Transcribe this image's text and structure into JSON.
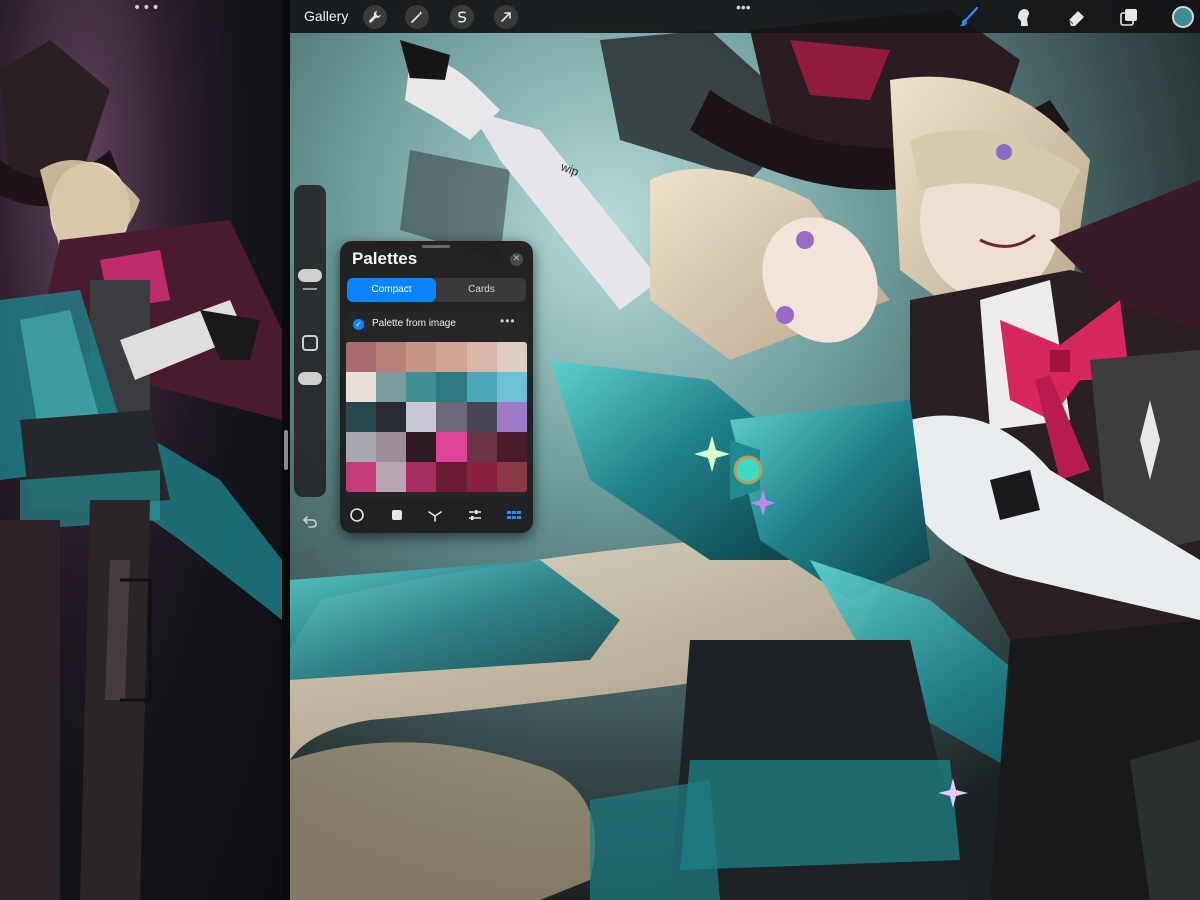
{
  "app": {
    "gallery_label": "Gallery",
    "toolbar_icons": [
      "wrench-icon",
      "magic-wand-icon",
      "selection-icon",
      "transform-arrow-icon",
      "brush-icon",
      "smudge-icon",
      "eraser-icon",
      "layers-icon",
      "color-swatch"
    ],
    "current_color": "#3e8b92",
    "accent": "#0a84ff"
  },
  "palettes": {
    "title": "Palettes",
    "tabs": [
      "Compact",
      "Cards"
    ],
    "active_tab": "Compact",
    "palette_name": "Palette from image",
    "default_checked": true,
    "swatches": [
      "#a86c6c",
      "#b88074",
      "#c89484",
      "#d2a494",
      "#dab6a8",
      "#e0cdc2",
      "#e8e0d8",
      "#7a9aa0",
      "#3f8e94",
      "#2e7a84",
      "#4aa8b8",
      "#6ec0d4",
      "#2a4850",
      "#2a2c34",
      "#c8c8d4",
      "#6a6a78",
      "#4a4458",
      "#a078c8",
      "#a8a8b0",
      "#9c8c96",
      "#301a24",
      "#e0449a",
      "#6a3444",
      "#4a1c2a",
      "#c43c7a",
      "#b8a4b0",
      "#a82c60",
      "#6a1c34",
      "#8a2040",
      "#8a3848"
    ],
    "bottom_tabs": [
      "disc-icon",
      "square-icon",
      "harmony-icon",
      "value-sliders-icon",
      "palettes-grid-icon"
    ],
    "active_bottom_tab": "palettes-grid-icon"
  }
}
